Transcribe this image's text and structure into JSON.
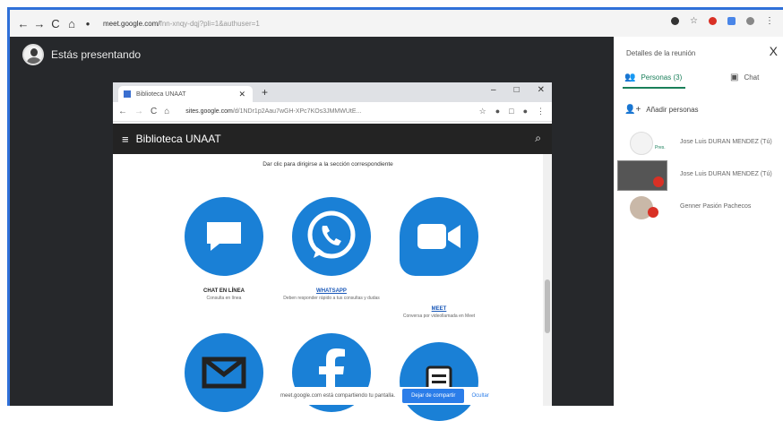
{
  "browser": {
    "url_domain": "meet.google.com/",
    "url_rest": "fnn-xnqy-dqj?pli=1&authuser=1",
    "colors": {
      "frame_border": "#2e6fd8",
      "stage": "#26282b",
      "accent": "#1a80d6",
      "people_tab": "#1a7f5a"
    }
  },
  "stage": {
    "presenting_label": "Estás presentando"
  },
  "inner_window": {
    "tab_title": "Biblioteca UNAAT",
    "url_domain": "sites.google.com",
    "url_rest": "/d/1NDr1p2Aau7wGH-XPc7KOs3JMMWUtE...",
    "site_title": "Biblioteca UNAAT",
    "instruction": "Dar clic para dirigirse a la sección correspondiente",
    "options": [
      {
        "icon": "chat-bubble-icon",
        "title": "CHAT EN LÍNEA",
        "desc": "Consulta en línea",
        "link": false
      },
      {
        "icon": "whatsapp-icon",
        "title": "WHATSAPP",
        "desc": "Deben responder rápido a tus consultas y dudas",
        "link": true
      },
      {
        "icon": "video-camera-icon",
        "title": "MEET",
        "desc": "Conversa por videollamada en Meet",
        "link": true
      },
      {
        "icon": "mail-icon",
        "title": "",
        "desc": "",
        "link": false
      },
      {
        "icon": "facebook-icon",
        "title": "",
        "desc": "",
        "link": false
      },
      {
        "icon": "document-icon",
        "title": "",
        "desc": "",
        "link": false
      }
    ]
  },
  "share_bar": {
    "text": "meet.google.com está compartiendo tu pantalla.",
    "stop_label": "Dejar de compartir",
    "hide_label": "Ocultar"
  },
  "panel": {
    "title": "Detalles de la reunión",
    "close": "X",
    "tab_people": "Personas (3)",
    "tab_chat": "Chat",
    "add_people": "Añadir personas",
    "people": [
      {
        "name": "Jose Luis DURAN MENDEZ (Tú)",
        "tag": "Pres."
      },
      {
        "name": "Jose Luis DURAN MENDEZ (Tú)",
        "tag": ""
      },
      {
        "name": "Genner Pasión Pachecos",
        "tag": ""
      }
    ]
  }
}
